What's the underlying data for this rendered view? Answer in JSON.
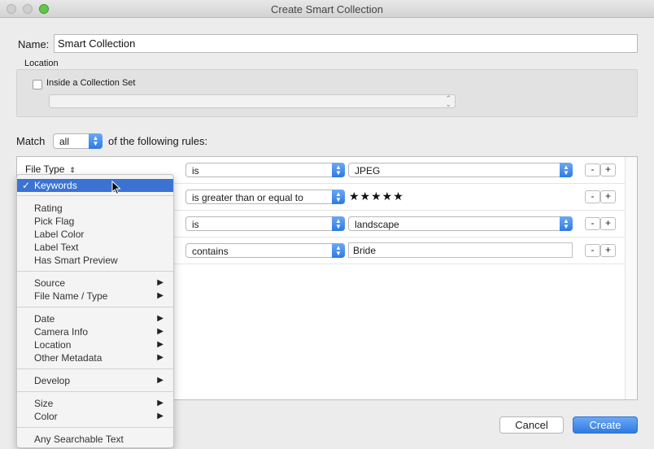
{
  "window": {
    "title": "Create Smart Collection"
  },
  "name": {
    "label": "Name:",
    "value": "Smart Collection"
  },
  "location": {
    "label": "Location",
    "inside_set_label": "Inside a Collection Set",
    "inside_set_checked": false,
    "set_value": ""
  },
  "match": {
    "label": "Match",
    "value": "all",
    "suffix": "of the following rules:"
  },
  "rules": [
    {
      "field": "File Type",
      "operator": "is",
      "value": "JPEG",
      "value_kind": "select"
    },
    {
      "field": "",
      "operator": "is greater than or equal to",
      "value": "★★★★★",
      "value_kind": "stars"
    },
    {
      "field": "",
      "operator": "is",
      "value": "landscape",
      "value_kind": "select"
    },
    {
      "field": "",
      "operator": "contains",
      "value": "Bride",
      "value_kind": "text"
    }
  ],
  "rule_buttons": {
    "remove": "-",
    "add": "+"
  },
  "menu": {
    "selected": "Keywords",
    "checkmark": "✓",
    "groups": [
      [
        "Keywords"
      ],
      [
        "Rating",
        "Pick Flag",
        "Label Color",
        "Label Text",
        "Has Smart Preview"
      ],
      [
        "Source",
        "File Name / Type"
      ],
      [
        "Date",
        "Camera Info",
        "Location",
        "Other Metadata"
      ],
      [
        "Develop"
      ],
      [
        "Size",
        "Color"
      ],
      [
        "Any Searchable Text"
      ]
    ],
    "items": {
      "keywords": "Keywords",
      "rating": "Rating",
      "pick_flag": "Pick Flag",
      "label_color": "Label Color",
      "label_text": "Label Text",
      "has_smart_preview": "Has Smart Preview",
      "source": "Source",
      "file_name_type": "File Name / Type",
      "date": "Date",
      "camera_info": "Camera Info",
      "location": "Location",
      "other_metadata": "Other Metadata",
      "develop": "Develop",
      "size": "Size",
      "color": "Color",
      "any_searchable_text": "Any Searchable Text"
    },
    "submenu_arrow": "▶"
  },
  "buttons": {
    "cancel": "Cancel",
    "create": "Create"
  },
  "colors": {
    "accent": "#3b73d3",
    "button_blue": "#2f7ae3"
  }
}
